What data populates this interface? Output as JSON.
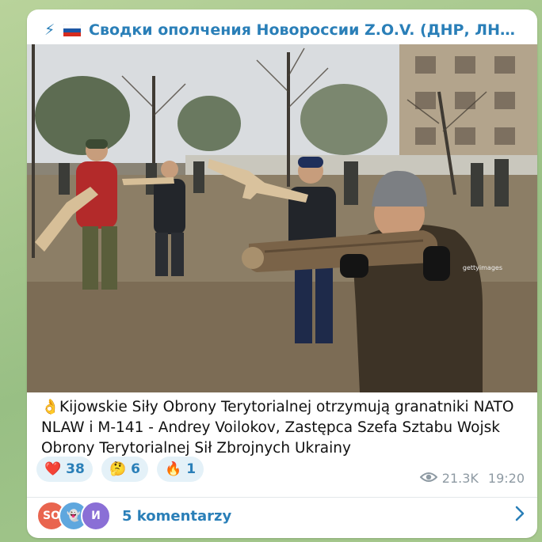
{
  "channel": {
    "title": "Сводки ополчения Новороссии Z.O.V. (ДНР, ЛНР, Укра...",
    "icons": [
      "lightning-icon",
      "russia-flag-icon"
    ]
  },
  "photo": {
    "watermark": "gettyimages",
    "alt_icon": "photo"
  },
  "caption": {
    "emoji": "👌",
    "text": "Kijowskie Siły Obrony Terytorialnej otrzymują granatniki NATO NLAW i M-141 - Andrey Voilokov, Zastępca Szefa Sztabu Wojsk Obrony Terytorialnej Sił Zbrojnych Ukrainy"
  },
  "reactions": [
    {
      "emoji": "❤️",
      "count": "38"
    },
    {
      "emoji": "🤔",
      "count": "6"
    },
    {
      "emoji": "🔥",
      "count": "1"
    }
  ],
  "meta": {
    "views": "21.3K",
    "time": "19:20"
  },
  "comments": {
    "avatars": [
      {
        "text": "SO",
        "color": "#e9654f"
      },
      {
        "text": "👻",
        "color": "#5fa7de"
      },
      {
        "text": "И",
        "color": "#8a6fd6"
      }
    ],
    "label": "5 komentarzy"
  }
}
